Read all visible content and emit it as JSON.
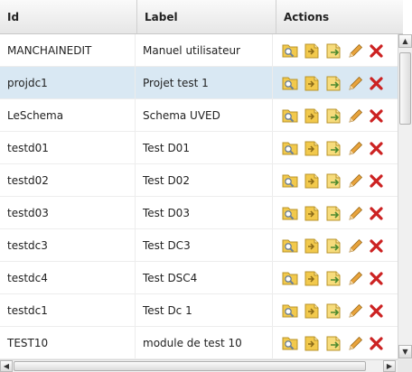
{
  "table": {
    "columns": [
      "Id",
      "Label",
      "Actions"
    ],
    "rows": [
      {
        "id": "MANCHAINEDIT",
        "label": "Manuel utilisateur",
        "selected": false
      },
      {
        "id": "projdc1",
        "label": "Projet test 1",
        "selected": true
      },
      {
        "id": "LeSchema",
        "label": "Schema UVED",
        "selected": false
      },
      {
        "id": "testd01",
        "label": "Test D01",
        "selected": false
      },
      {
        "id": "testd02",
        "label": "Test D02",
        "selected": false
      },
      {
        "id": "testd03",
        "label": "Test D03",
        "selected": false
      },
      {
        "id": "testdc3",
        "label": "Test DC3",
        "selected": false
      },
      {
        "id": "testdc4",
        "label": "Test DSC4",
        "selected": false
      },
      {
        "id": "testdc1",
        "label": "Test Dc 1",
        "selected": false
      },
      {
        "id": "TEST10",
        "label": "module de test 10",
        "selected": false
      }
    ],
    "action_icons": [
      "view-document-icon",
      "export-document-icon",
      "move-document-icon",
      "edit-pencil-icon",
      "delete-icon"
    ]
  },
  "colors": {
    "selected_row": "#d9e8f3",
    "header_bg": "#e6e6e6",
    "folder_yellow": "#f2c94c",
    "pencil": "#e8a33c",
    "delete_red": "#cc2222"
  }
}
